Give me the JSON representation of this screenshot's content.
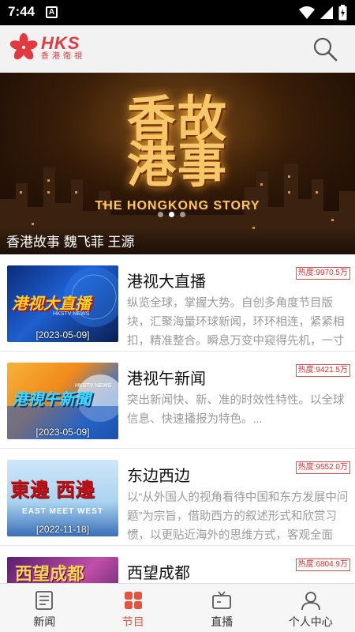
{
  "status_bar": {
    "time": "7:44",
    "notification_badge": "A"
  },
  "header": {
    "logo_text": "HKS",
    "logo_subtitle": "香港衛視",
    "search_icon": "search-icon",
    "brand_color": "#e03a3e"
  },
  "banner": {
    "title_cn_line1": "香故",
    "title_cn_line2": "港事",
    "title_en": "THE HONGKONG STORY",
    "caption": "香港故事   魏飞菲   王源",
    "active_dot": 1,
    "dot_count": 3
  },
  "programs": [
    {
      "title": "港视大直播",
      "hot": "热度:9970.5万",
      "description": "纵览全球，掌握大势。自创多角度节目版块，汇聚海量环球新闻，环环相连，紧紧相扣，精准整合。瞬息万变中窥得先机，一寸",
      "thumb_title": "港视大直播",
      "thumb_sub": "HKSTV NEWS",
      "thumb_date": "[2023-05-09]"
    },
    {
      "title": "港视午新闻",
      "hot": "热度:9421.5万",
      "description": "突出新闻快、新、准的时效性特性。以全球信息、快速播报为特色。...",
      "thumb_title": "港視午新聞",
      "thumb_sub": "HKSTV NEWS",
      "thumb_date": "[2023-05-09]"
    },
    {
      "title": "东边西边",
      "hot": "热度:9552.0万",
      "description": "以“从外国人的视角看待中国和东方发展中问题”为宗旨，借助西方的叙述形式和欣赏习惯，以更贴近海外的思维方式，客观全面",
      "thumb_title": "東邊 西邊",
      "thumb_sub": "EAST MEET WEST",
      "thumb_date": "[2022-11-18]"
    },
    {
      "title": "西望成都",
      "hot": "热度:6804.9万",
      "description": "",
      "thumb_title": "西望成都",
      "thumb_sub": "",
      "thumb_date": ""
    }
  ],
  "bottom_nav": {
    "items": [
      {
        "label": "新闻",
        "icon": "news-icon"
      },
      {
        "label": "节目",
        "icon": "programs-grid-icon"
      },
      {
        "label": "直播",
        "icon": "tv-live-icon"
      },
      {
        "label": "个人中心",
        "icon": "user-icon"
      }
    ],
    "active_index": 1,
    "active_color": "#e8533e"
  }
}
